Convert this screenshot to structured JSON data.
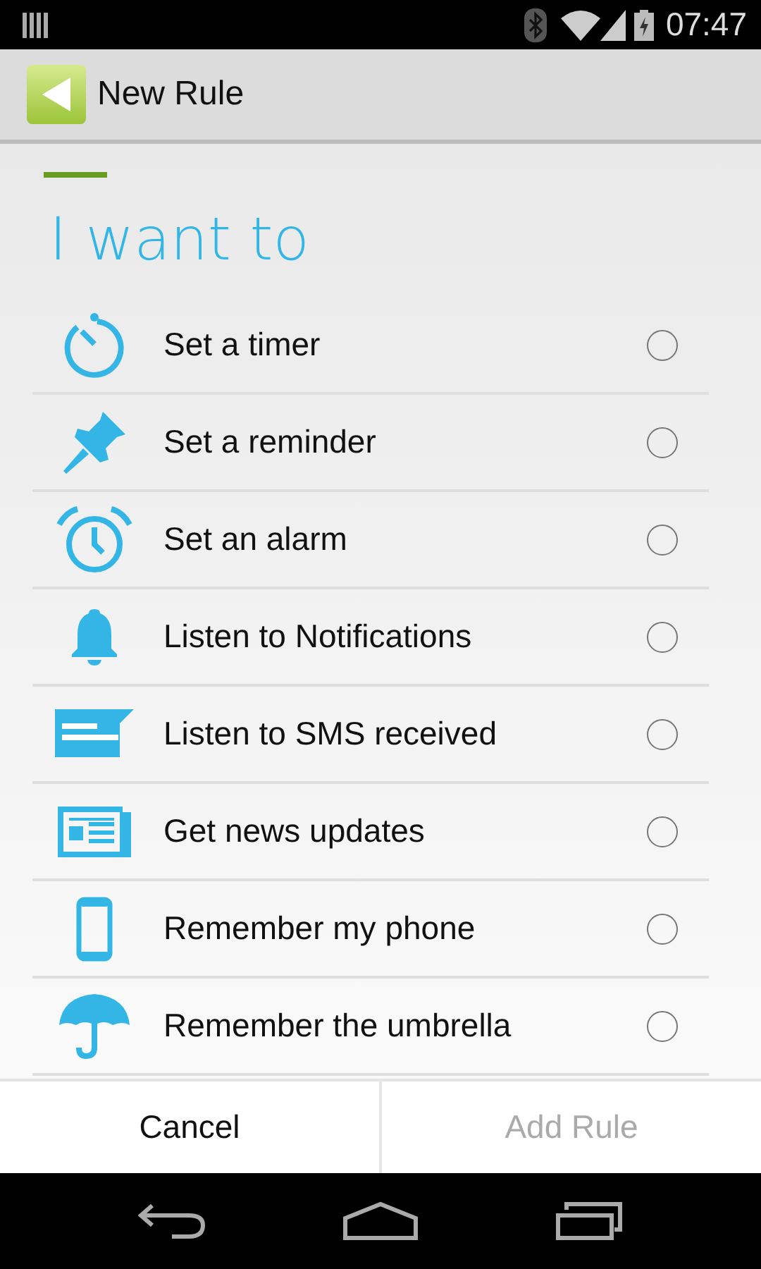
{
  "status_bar": {
    "time": "07:47"
  },
  "action_bar": {
    "title": "New Rule"
  },
  "heading": "I want to",
  "options": [
    {
      "kind": "timer",
      "label": "Set a timer",
      "selected": false
    },
    {
      "kind": "pin",
      "label": "Set a reminder",
      "selected": false
    },
    {
      "kind": "alarm",
      "label": "Set an alarm",
      "selected": false
    },
    {
      "kind": "bell",
      "label": "Listen to Notifications",
      "selected": false
    },
    {
      "kind": "sms",
      "label": "Listen to SMS received",
      "selected": false
    },
    {
      "kind": "news",
      "label": "Get news updates",
      "selected": false
    },
    {
      "kind": "phone",
      "label": "Remember my phone",
      "selected": false
    },
    {
      "kind": "umbrella",
      "label": "Remember the umbrella",
      "selected": false
    }
  ],
  "buttons": [
    {
      "label": "Cancel",
      "disabled": false
    },
    {
      "label": "Add Rule",
      "disabled": true
    }
  ]
}
